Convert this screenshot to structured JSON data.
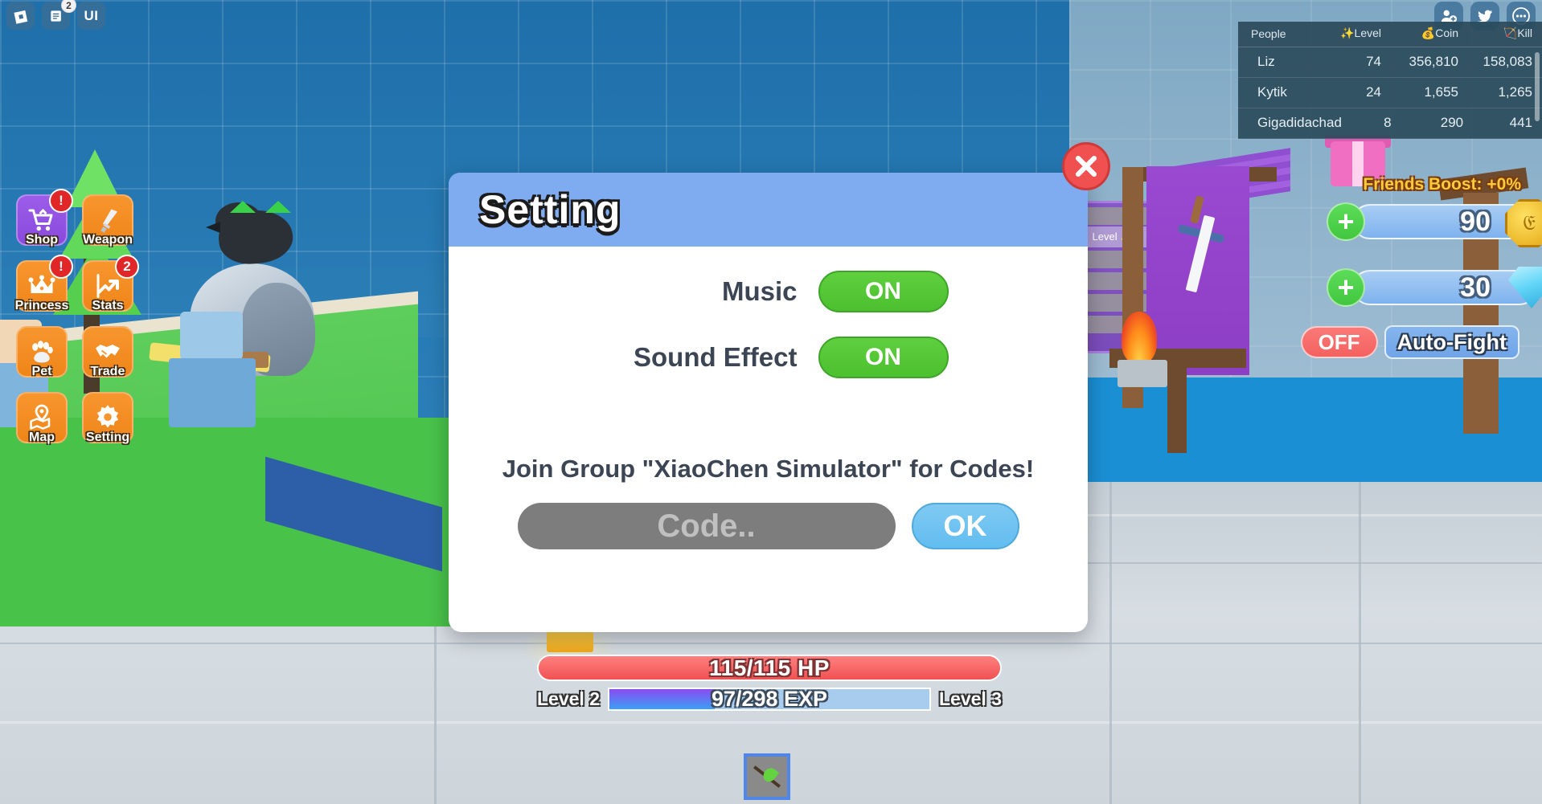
{
  "topbar": {
    "roblox_icon": "roblox-logo-icon",
    "chat_icon": "chat-icon",
    "chat_badge": "2",
    "ui_button_label": "UI"
  },
  "top_right_icons": [
    {
      "name": "add-friend-icon",
      "label": "Add Friend"
    },
    {
      "name": "twitter-icon",
      "label": "Twitter"
    },
    {
      "name": "more-options-icon",
      "label": "More"
    }
  ],
  "leaderboard": {
    "columns": [
      "People",
      "Level",
      "Coin",
      "Kill"
    ],
    "level_icon": "sparkle-icon",
    "coin_icon": "coin-bag-icon",
    "kill_icon": "kill-icon",
    "rows": [
      {
        "name": "Liz",
        "level": "74",
        "coin": "356,810",
        "kill": "158,083"
      },
      {
        "name": "Kytik",
        "level": "24",
        "coin": "1,655",
        "kill": "1,265"
      },
      {
        "name": "Gigadidachad",
        "level": "8",
        "coin": "290",
        "kill": "441"
      }
    ]
  },
  "left_menu": [
    {
      "label": "Shop",
      "icon": "shopping-cart-icon",
      "badge": "!",
      "color": "#9b5de8"
    },
    {
      "label": "Weapon",
      "icon": "sword-icon",
      "badge": "",
      "color": "#f7962e"
    },
    {
      "label": "Princess",
      "icon": "crown-icon",
      "badge": "!",
      "color": "#f7962e"
    },
    {
      "label": "Stats",
      "icon": "chart-up-icon",
      "badge": "2",
      "color": "#f7962e"
    },
    {
      "label": "Pet",
      "icon": "paw-icon",
      "badge": "",
      "color": "#f7962e"
    },
    {
      "label": "Trade",
      "icon": "handshake-icon",
      "badge": "",
      "color": "#f7962e"
    },
    {
      "label": "Map",
      "icon": "map-pin-icon",
      "badge": "",
      "color": "#f7962e"
    },
    {
      "label": "Setting",
      "icon": "gear-icon",
      "badge": "",
      "color": "#f7962e"
    }
  ],
  "hud": {
    "friends_boost": "Friends Boost: +0%",
    "coin_value": "90",
    "coin_icon": "gold-coin-icon",
    "gem_value": "30",
    "gem_icon": "diamond-gem-icon",
    "add_icon": "plus-icon",
    "autofight_state": "OFF",
    "autofight_label": "Auto-Fight"
  },
  "player_bars": {
    "hp_text": "115/115 HP",
    "hp_percent": 100,
    "exp_text": "97/298 EXP",
    "exp_percent": 33,
    "level_current": "Level 2",
    "level_next": "Level 3"
  },
  "hotbar": {
    "slot_item": "stick-item-icon"
  },
  "dialog": {
    "title": "Setting",
    "close_icon": "close-x-icon",
    "rows": [
      {
        "label": "Music",
        "toggle": "ON"
      },
      {
        "label": "Sound Effect",
        "toggle": "ON"
      }
    ],
    "join_text": "Join Group \"XiaoChen Simulator\" for Codes!",
    "code_placeholder": "Code..",
    "code_value": "",
    "ok_label": "OK"
  },
  "colors": {
    "header_blue": "#7fabf0",
    "toggle_green": "#4cc02f",
    "ok_blue": "#62bdf0",
    "close_red": "#f0504f",
    "accent_orange": "#f7962e",
    "boost_gold": "#ffc93c"
  }
}
